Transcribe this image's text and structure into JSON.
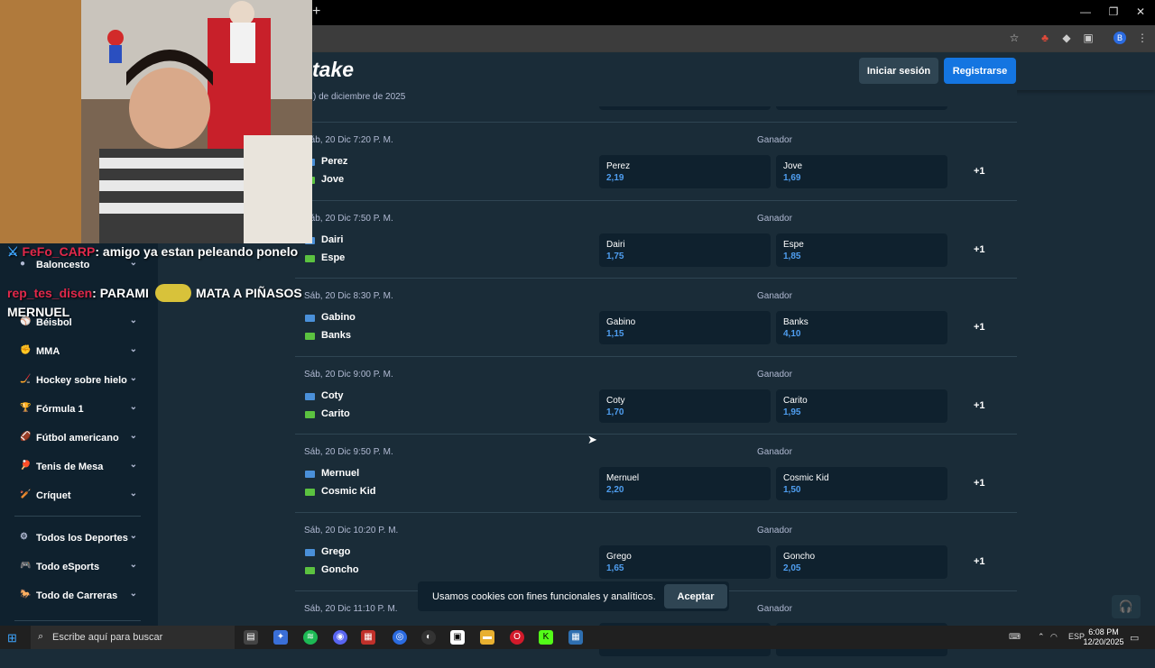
{
  "browser": {
    "newtab_glyph": "+",
    "minimize_glyph": "—",
    "restore_glyph": "❐",
    "close_glyph": "✕",
    "profile_initial": "B",
    "toolbar_icons": [
      "star-icon",
      "extension-icon",
      "extension-icon",
      "puzzle-icon",
      "menu-icon"
    ]
  },
  "site": {
    "logo": "take",
    "login_label": "Iniciar sesión",
    "register_label": "Registrarse",
    "date_header": ") de diciembre de 2025"
  },
  "sidebar": {
    "items": [
      {
        "label": "Baloncesto",
        "icon": "basketball-icon",
        "glyph": "●"
      },
      {
        "label": "Béisbol",
        "icon": "baseball-icon",
        "glyph": "⚾"
      },
      {
        "label": "MMA",
        "icon": "mma-icon",
        "glyph": "✊"
      },
      {
        "label": "Hockey sobre hielo",
        "icon": "hockey-icon",
        "glyph": "🏒"
      },
      {
        "label": "Fórmula 1",
        "icon": "trophy-icon",
        "glyph": "🏆"
      },
      {
        "label": "Fútbol americano",
        "icon": "football-icon",
        "glyph": "🏈"
      },
      {
        "label": "Tenis de Mesa",
        "icon": "table-tennis-icon",
        "glyph": "🏓"
      },
      {
        "label": "Críquet",
        "icon": "cricket-icon",
        "glyph": "🏏"
      },
      {
        "label": "Todos los Deportes",
        "icon": "sports-icon",
        "glyph": "⚙"
      },
      {
        "label": "Todo eSports",
        "icon": "esports-icon",
        "glyph": "🎮"
      },
      {
        "label": "Todo de Carreras",
        "icon": "racing-icon",
        "glyph": "🐎"
      }
    ]
  },
  "market_label": "Ganador",
  "more_label": "+1",
  "events": [
    {
      "time": "Sáb, 20 Dic  7:20 P. M.",
      "team1": "Perez",
      "team2": "Jove",
      "odd1": "2,19",
      "odd2": "1,69"
    },
    {
      "time": "Sáb, 20 Dic  7:50 P. M.",
      "team1": "Dairi",
      "team2": "Espe",
      "odd1": "1,75",
      "odd2": "1,85"
    },
    {
      "time": "Sáb, 20 Dic  8:30 P. M.",
      "team1": "Gabino",
      "team2": "Banks",
      "odd1": "1,15",
      "odd2": "4,10"
    },
    {
      "time": "Sáb, 20 Dic  9:00 P. M.",
      "team1": "Coty",
      "team2": "Carito",
      "odd1": "1,70",
      "odd2": "1,95"
    },
    {
      "time": "Sáb, 20 Dic  9:50 P. M.",
      "team1": "Mernuel",
      "team2": "Cosmic Kid",
      "odd1": "2,20",
      "odd2": "1,50"
    },
    {
      "time": "Sáb, 20 Dic  10:20 P. M.",
      "team1": "Grego",
      "team2": "Goncho",
      "odd1": "1,65",
      "odd2": "2,05"
    },
    {
      "time": "Sáb, 20 Dic  11:10 P. M.",
      "team1": "",
      "team2": "",
      "odd1": "",
      "odd2": ""
    }
  ],
  "cookie": {
    "text": "Usamos cookies con fines funcionales y analíticos.",
    "accept_label": "Aceptar"
  },
  "stream_chat": [
    {
      "user": "FeFo_CARP",
      "message": ": amigo ya estan peleando ponelo"
    },
    {
      "user": "rep_tes_disen",
      "message": ": PARAMI"
    },
    {
      "user": "",
      "message": "MATA A PIÑASOS"
    },
    {
      "user": "",
      "message": "MERNUEL"
    }
  ],
  "taskbar": {
    "search_placeholder": "Escribe aquí para buscar",
    "tray_lang": "ESP",
    "time": "6:08 PM",
    "date": "12/20/2025"
  },
  "colors": {
    "bg": "#1a2c38",
    "panel": "#0f212e",
    "accent_blue": "#1475e1",
    "odds_blue": "#4f9ef0"
  }
}
